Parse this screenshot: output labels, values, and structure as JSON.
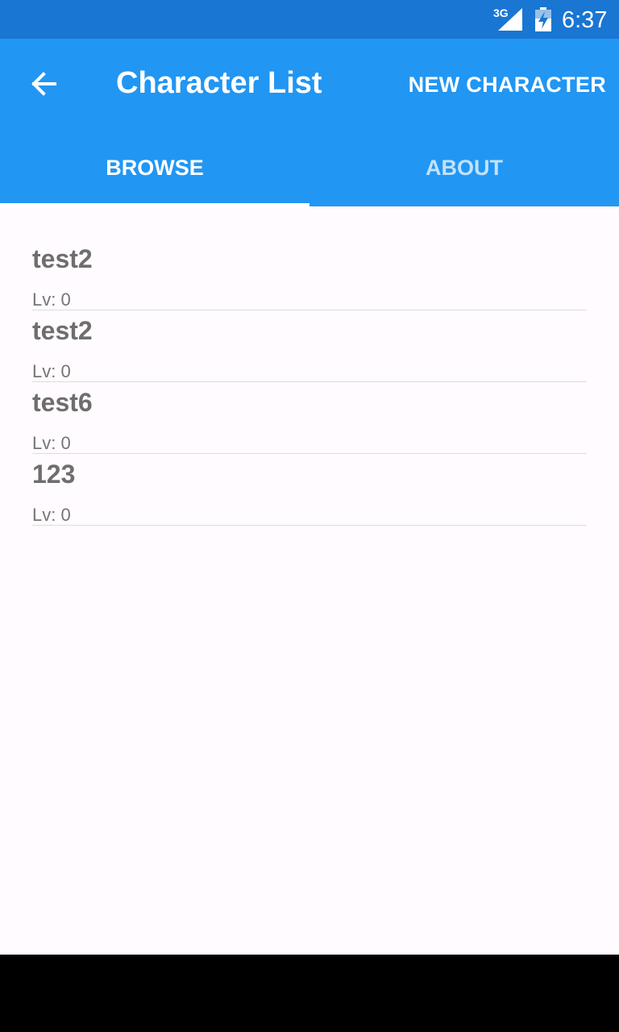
{
  "status_bar": {
    "network": "3G",
    "time": "6:37",
    "icons": [
      "signal-icon",
      "battery-charging-icon"
    ]
  },
  "app_bar": {
    "title": "Character List",
    "action_label": "NEW CHARACTER",
    "back_icon": "arrow-back-icon"
  },
  "tabs": [
    {
      "label": "BROWSE",
      "active": true
    },
    {
      "label": "ABOUT",
      "active": false
    }
  ],
  "characters": [
    {
      "name": "test2",
      "level": "Lv: 0"
    },
    {
      "name": "test2",
      "level": "Lv: 0"
    },
    {
      "name": "test6",
      "level": "Lv: 0"
    },
    {
      "name": "123",
      "level": "Lv: 0"
    }
  ],
  "colors": {
    "status_bar": "#1976D2",
    "app_bar": "#2196F3",
    "background": "#FFFBFE"
  }
}
